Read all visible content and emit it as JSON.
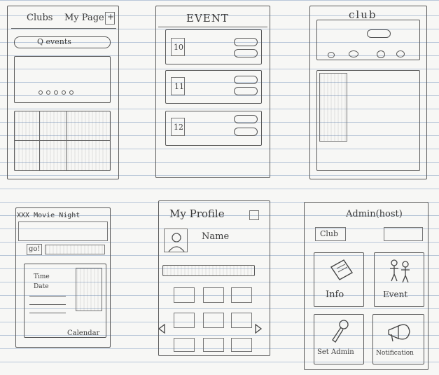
{
  "screens": {
    "home": {
      "nav_clubs": "Clubs",
      "nav_mypage": "My Page",
      "nav_plus": "+",
      "search_placeholder": "Q events"
    },
    "event_list": {
      "title": "EVENT",
      "dates": [
        "10",
        "11",
        "12"
      ]
    },
    "club": {
      "title": "club"
    },
    "event_detail": {
      "title": "XXX Movie Night",
      "button": "go!",
      "time_label": "Time",
      "date_label": "Date",
      "calendar_label": "Calendar"
    },
    "profile": {
      "title": "My Profile",
      "name_label": "Name"
    },
    "admin": {
      "title": "Admin(host)",
      "club_label": "Club",
      "tiles": [
        {
          "label": "Info",
          "icon": "document-icon"
        },
        {
          "label": "Event",
          "icon": "people-icon"
        },
        {
          "label": "Set Admin",
          "icon": "wrench-icon"
        },
        {
          "label": "Notification",
          "icon": "megaphone-icon"
        }
      ]
    }
  }
}
